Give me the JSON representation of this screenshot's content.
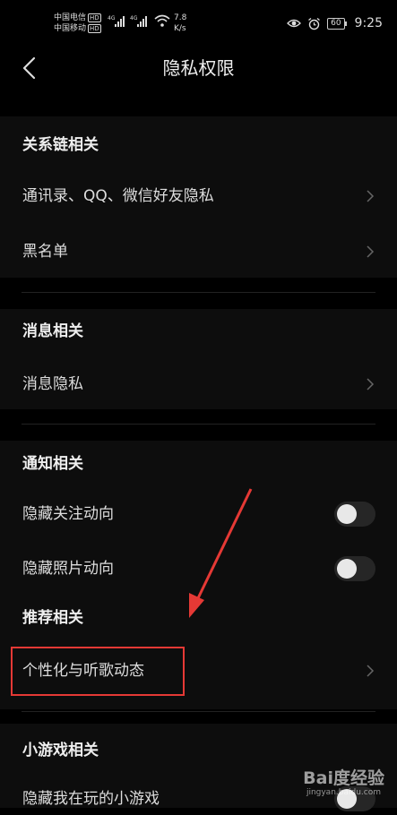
{
  "status_bar": {
    "carrier1": "中国电信",
    "carrier2": "中国移动",
    "hd": "HD",
    "net1": "4G",
    "net2": "4G",
    "speed_value": "7.8",
    "speed_unit": "K/s",
    "battery": "60",
    "time": "9:25"
  },
  "header": {
    "title": "隐私权限"
  },
  "sections": {
    "relations": {
      "title": "关系链相关",
      "items": [
        "通讯录、QQ、微信好友隐私",
        "黑名单"
      ]
    },
    "messages": {
      "title": "消息相关",
      "items": [
        "消息隐私"
      ]
    },
    "notifications": {
      "title": "通知相关",
      "toggles": [
        {
          "label": "隐藏关注动向",
          "on": false
        },
        {
          "label": "隐藏照片动向",
          "on": false
        }
      ]
    },
    "recommend": {
      "title": "推荐相关",
      "items": [
        "个性化与听歌动态"
      ]
    },
    "minigame": {
      "title": "小游戏相关",
      "toggles": [
        {
          "label": "隐藏我在玩的小游戏",
          "on": false
        }
      ]
    }
  },
  "watermark": {
    "main": "Bai度经验",
    "sub": "jingyan.baidu.com"
  },
  "colors": {
    "background": "#000000",
    "highlight": "#e53935"
  },
  "icons": [
    "back-arrow-icon",
    "chevron-right-icon",
    "eye-icon",
    "alarm-icon",
    "battery-icon",
    "wifi-icon",
    "signal-icon"
  ]
}
